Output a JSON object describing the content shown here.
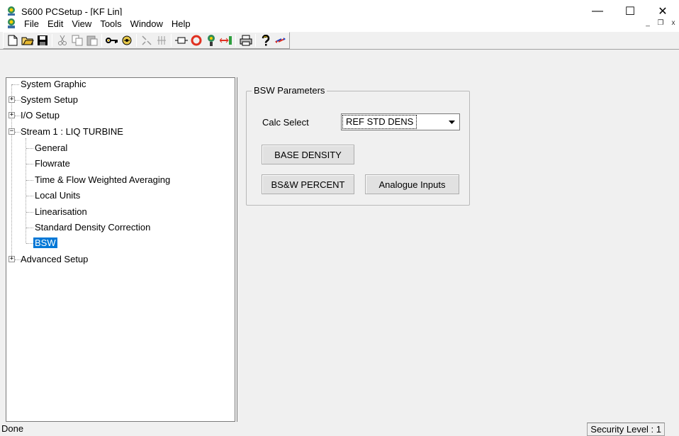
{
  "window": {
    "title": "S600 PCSetup  - [KF Lin]",
    "minimize_glyph": "—",
    "maximize_glyph": "☐",
    "close_glyph": "✕"
  },
  "menu": {
    "items": [
      "File",
      "Edit",
      "View",
      "Tools",
      "Window",
      "Help"
    ],
    "mdi_min": "_",
    "mdi_restore": "❐",
    "mdi_close": "x"
  },
  "toolbar": {
    "icons": [
      "new-icon",
      "open-icon",
      "save-icon",
      "cut-icon",
      "copy-icon",
      "paste-icon",
      "key-icon",
      "security-icon",
      "link-icon",
      "transfer-icon",
      "port-icon",
      "stop-icon",
      "connect-icon",
      "send-icon",
      "print-icon",
      "help-icon",
      "swap-icon"
    ]
  },
  "tree": {
    "items": [
      {
        "label": "System Graphic",
        "level": 0,
        "expander": ""
      },
      {
        "label": "System Setup",
        "level": 0,
        "expander": "+"
      },
      {
        "label": "I/O Setup",
        "level": 0,
        "expander": "+"
      },
      {
        "label": "Stream 1 : LIQ TURBINE",
        "level": 0,
        "expander": "−"
      },
      {
        "label": "General",
        "level": 1,
        "expander": ""
      },
      {
        "label": "Flowrate",
        "level": 1,
        "expander": ""
      },
      {
        "label": "Time & Flow Weighted Averaging",
        "level": 1,
        "expander": ""
      },
      {
        "label": "Local Units",
        "level": 1,
        "expander": ""
      },
      {
        "label": "Linearisation",
        "level": 1,
        "expander": ""
      },
      {
        "label": "Standard Density Correction",
        "level": 1,
        "expander": ""
      },
      {
        "label": "BSW",
        "level": 1,
        "expander": "",
        "selected": true
      },
      {
        "label": "Advanced Setup",
        "level": 0,
        "expander": "+"
      }
    ]
  },
  "panel": {
    "group_title": "BSW Parameters",
    "calc_select_label": "Calc Select",
    "calc_select_value": "REF STD DENS",
    "base_density_button": "BASE DENSITY",
    "bsw_percent_button": "BS&W PERCENT",
    "analogue_inputs_button": "Analogue Inputs"
  },
  "status": {
    "text": "Done",
    "security": "Security Level : 1"
  }
}
